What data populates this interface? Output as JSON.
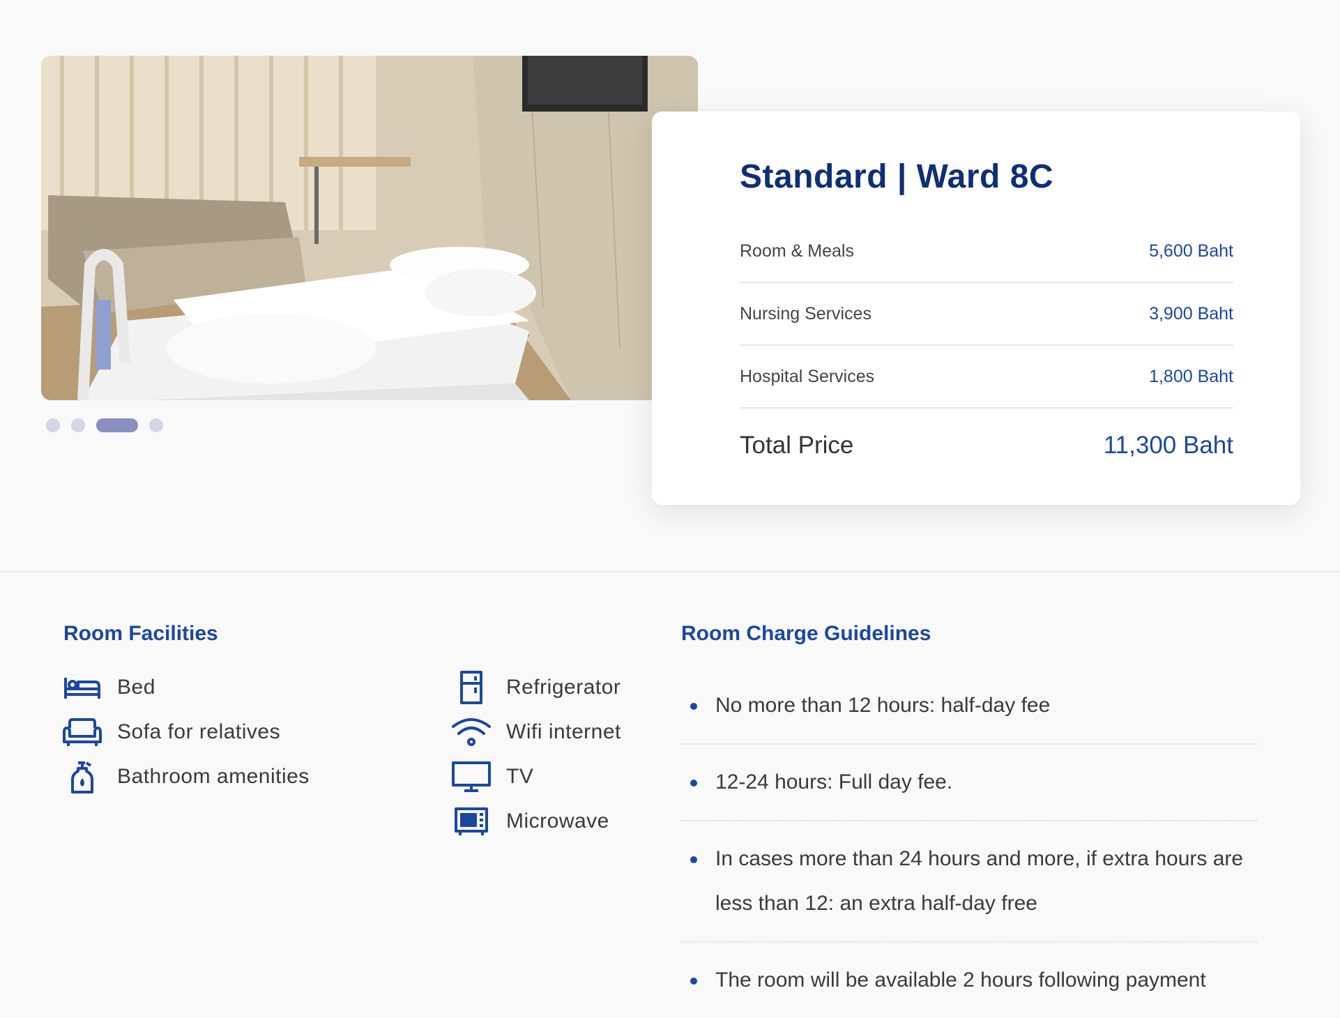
{
  "gallery": {
    "slides": 4,
    "active_slide": 3,
    "image_alt": "hospital room photo"
  },
  "room": {
    "title": "Standard | Ward 8C",
    "prices": [
      {
        "label": "Room & Meals",
        "value": "5,600 Baht"
      },
      {
        "label": "Nursing Services",
        "value": "3,900 Baht"
      },
      {
        "label": "Hospital Services",
        "value": "1,800 Baht"
      }
    ],
    "total": {
      "label": "Total Price",
      "value": "11,300 Baht"
    }
  },
  "facilities": {
    "title": "Room Facilities",
    "left": [
      {
        "label": "Bed",
        "icon": "bed-icon"
      },
      {
        "label": "Sofa for relatives",
        "icon": "sofa-icon"
      },
      {
        "label": "Bathroom amenities",
        "icon": "soap-bottle-icon"
      }
    ],
    "right": [
      {
        "label": "Refrigerator",
        "icon": "refrigerator-icon"
      },
      {
        "label": "Wifi internet",
        "icon": "wifi-icon"
      },
      {
        "label": "TV",
        "icon": "tv-icon"
      },
      {
        "label": "Microwave",
        "icon": "microwave-icon"
      }
    ]
  },
  "guidelines": {
    "title": "Room Charge Guidelines",
    "items": [
      "No more than 12 hours: half-day fee",
      "12-24 hours: Full day fee.",
      "In cases more than 24 hours and more, if extra hours are less than 12: an extra half-day free",
      "The room will be available 2 hours following payment"
    ]
  },
  "colors": {
    "title_navy": "#0f2f74",
    "accent_blue": "#1c47a0",
    "dot_inactive": "#d3d6e6",
    "dot_active": "#8a90c2"
  }
}
